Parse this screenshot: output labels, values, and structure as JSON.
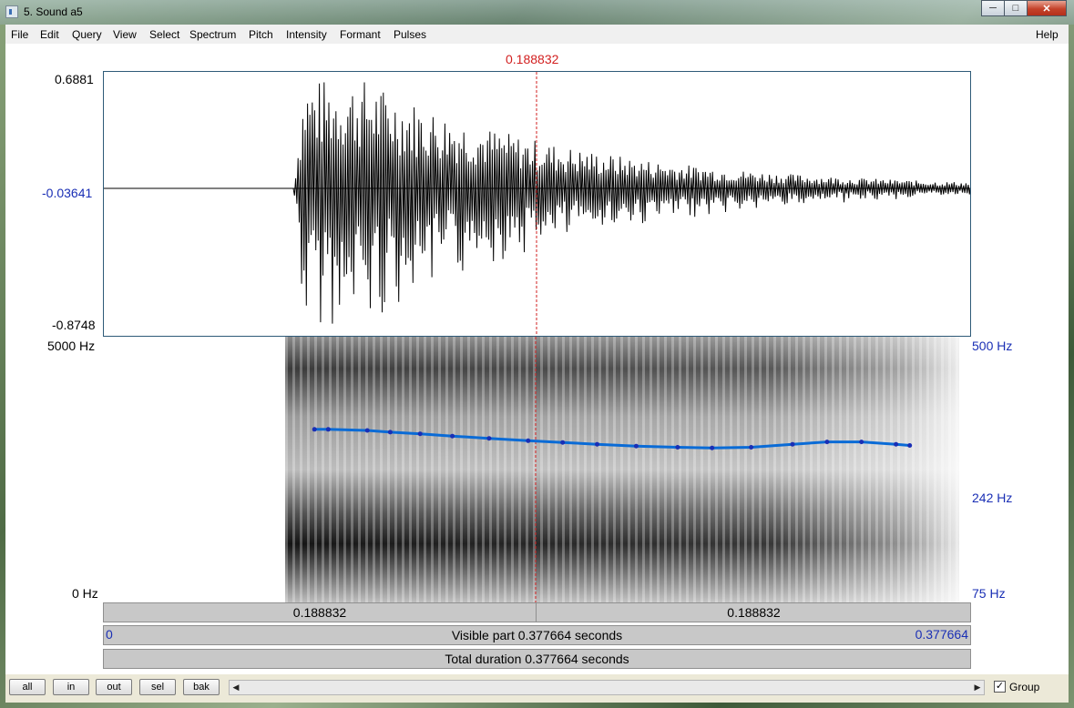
{
  "window": {
    "title": "5. Sound a5"
  },
  "menu": {
    "items": [
      "File",
      "Edit",
      "Query",
      "View",
      "Select",
      "Spectrum",
      "Pitch",
      "Intensity",
      "Formant",
      "Pulses"
    ],
    "help": "Help"
  },
  "cursor": {
    "time_label": "0.188832",
    "time": 0.188832
  },
  "waveform": {
    "ymax": "0.6881",
    "ymid": "-0.03641",
    "ymin": "-0.8748"
  },
  "spectrogram": {
    "fmax": "5000 Hz",
    "fmin": "0 Hz",
    "pitch_max": "500 Hz",
    "pitch_mid": "242 Hz",
    "pitch_min": "75 Hz"
  },
  "chart_data": {
    "type": "line",
    "series": [
      {
        "values": [
          [
            0.092,
            258
          ],
          [
            0.098,
            258
          ],
          [
            0.115,
            256
          ],
          [
            0.125,
            253
          ],
          [
            0.138,
            250
          ],
          [
            0.152,
            246
          ],
          [
            0.168,
            242
          ],
          [
            0.185,
            238
          ],
          [
            0.2,
            235
          ],
          [
            0.215,
            232
          ],
          [
            0.232,
            229
          ],
          [
            0.25,
            227
          ],
          [
            0.265,
            226
          ],
          [
            0.282,
            227
          ],
          [
            0.3,
            232
          ],
          [
            0.315,
            236
          ],
          [
            0.33,
            236
          ],
          [
            0.345,
            232
          ],
          [
            0.351,
            230
          ]
        ]
      }
    ],
    "xlim": [
      0,
      0.377664
    ],
    "ylim": [
      75,
      500
    ],
    "ylabel": ""
  },
  "timebar": {
    "left_label": "0.188832",
    "right_label": "0.188832",
    "visible_start": "0",
    "visible_label": "Visible part 0.377664 seconds",
    "visible_end": "0.377664",
    "total_label": "Total duration 0.377664 seconds"
  },
  "toolbar": {
    "buttons": [
      "all",
      "in",
      "out",
      "sel",
      "bak"
    ],
    "group_label": "Group",
    "group_checked": true
  }
}
